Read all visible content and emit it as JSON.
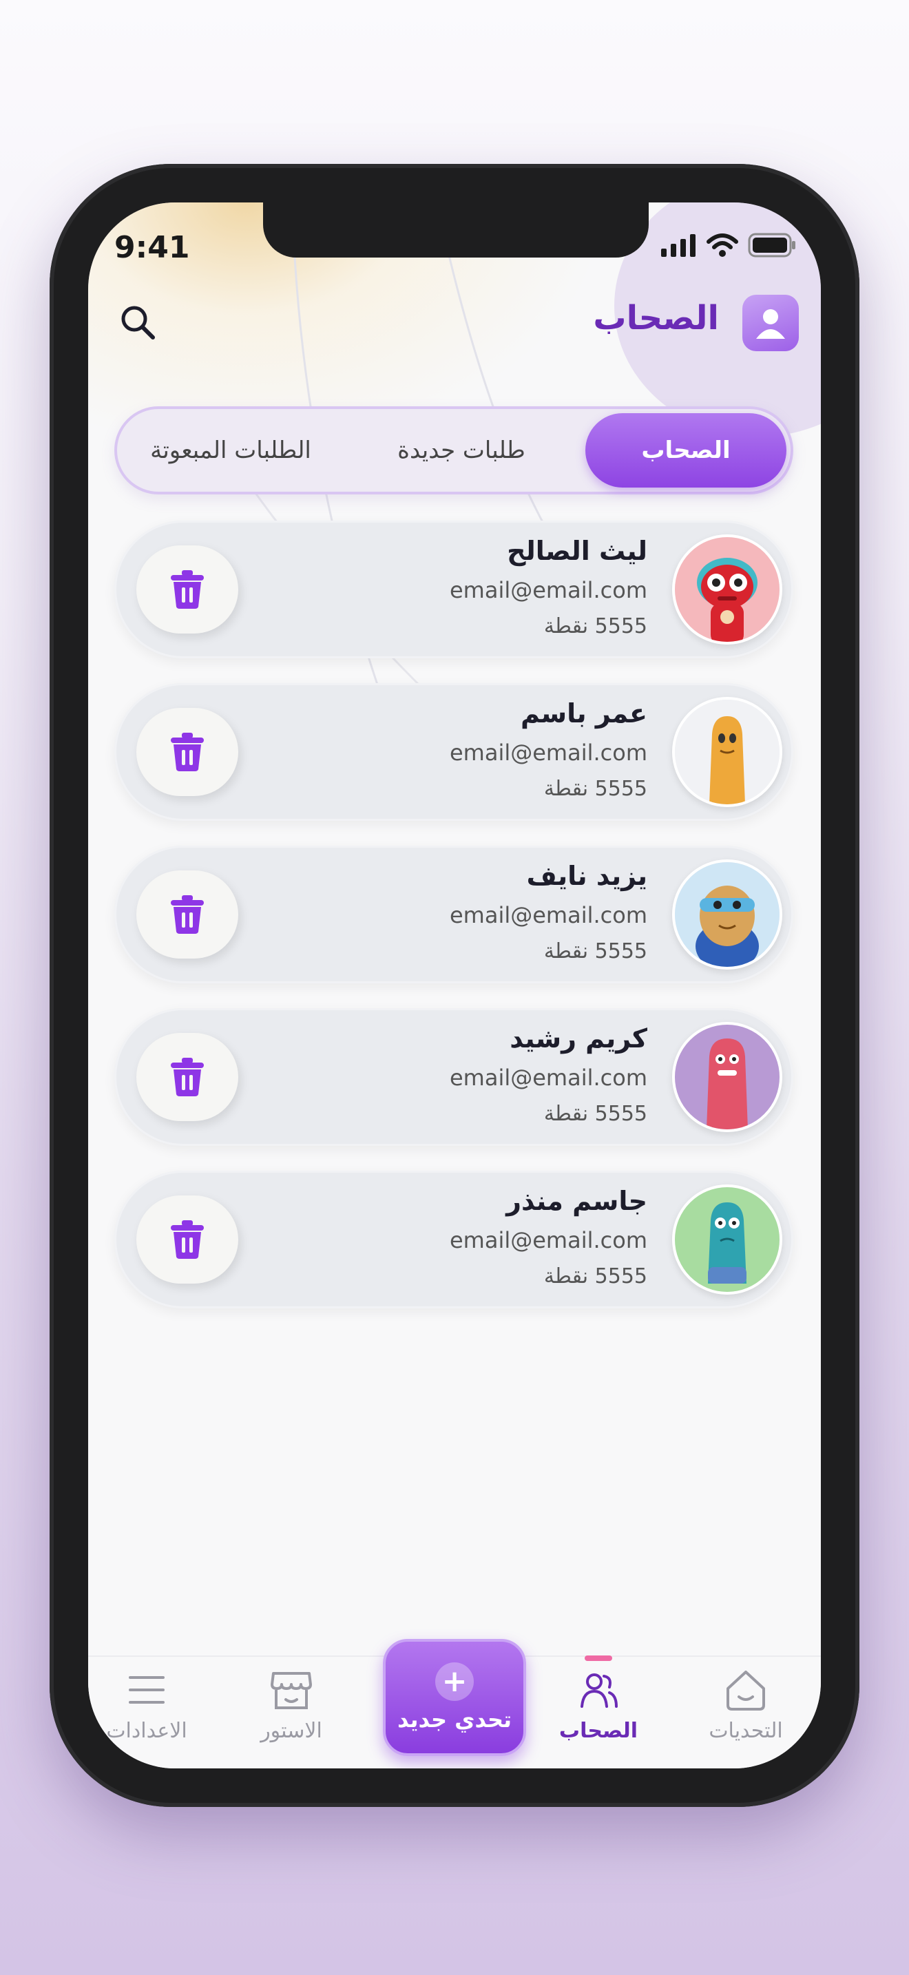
{
  "status_bar": {
    "time": "9:41"
  },
  "header": {
    "title": "الصحاب"
  },
  "tabs": [
    {
      "label": "الصحاب",
      "active": true
    },
    {
      "label": "طلبات جديدة",
      "active": false
    },
    {
      "label": "الطلبات المبعوتة",
      "active": false
    }
  ],
  "friends": [
    {
      "name": "ليث الصالح",
      "email": "email@email.com",
      "points": "5555 نقطة",
      "avatar": "red-robot-avatar"
    },
    {
      "name": "عمر باسم",
      "email": "email@email.com",
      "points": "5555 نقطة",
      "avatar": "orange-blob-avatar"
    },
    {
      "name": "يزيد نايف",
      "email": "email@email.com",
      "points": "5555 نقطة",
      "avatar": "superhero-avatar"
    },
    {
      "name": "كريم رشيد",
      "email": "email@email.com",
      "points": "5555 نقطة",
      "avatar": "pink-monster-avatar"
    },
    {
      "name": "جاسم منذر",
      "email": "email@email.com",
      "points": "5555 نقطة",
      "avatar": "teal-monster-avatar"
    }
  ],
  "bottom_nav": {
    "challenges": "التحديات",
    "friends": "الصحاب",
    "new_challenge": "تحدي جديد",
    "store": "الاستور",
    "settings": "الاعدادات"
  },
  "colors": {
    "accent": "#8e44e3",
    "title": "#6a2bb5",
    "indicator": "#ef6aa4"
  }
}
